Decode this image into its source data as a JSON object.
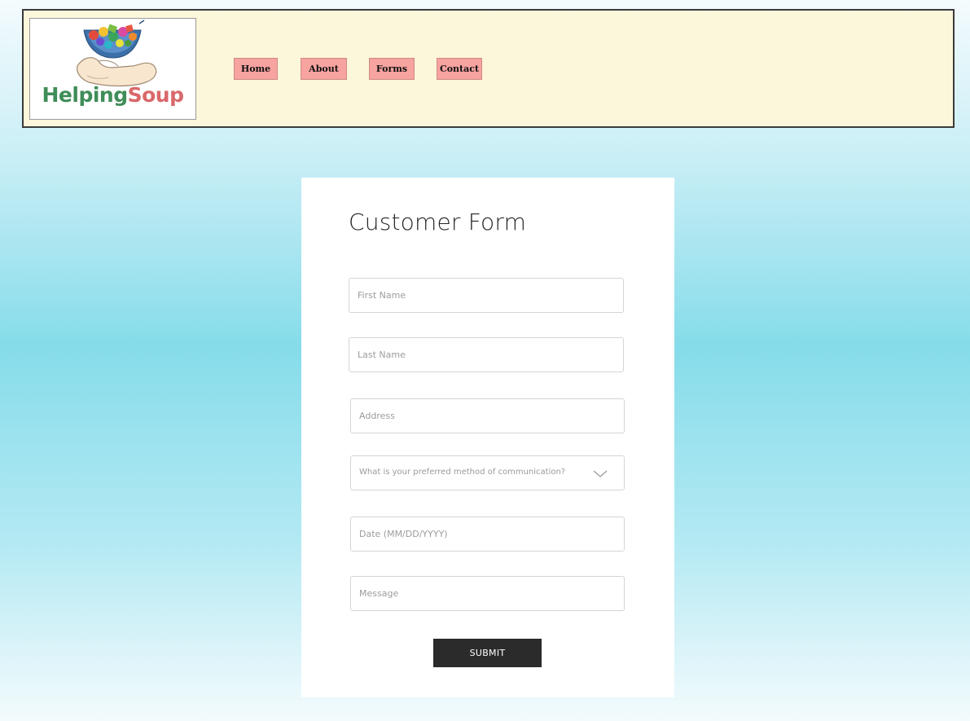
{
  "header": {
    "logo": {
      "word_part1": "Helping",
      "word_part2": "Soup",
      "icon": "hand-holding-bowl-logo"
    },
    "nav": [
      {
        "label": "Home"
      },
      {
        "label": "About"
      },
      {
        "label": "Forms"
      },
      {
        "label": "Contact"
      }
    ]
  },
  "form": {
    "title": "Customer Form",
    "fields": {
      "first_name": {
        "placeholder": "First Name",
        "value": ""
      },
      "last_name": {
        "placeholder": "Last Name",
        "value": ""
      },
      "address": {
        "placeholder": "Address",
        "value": ""
      },
      "communication": {
        "selected": "What is your preferred method of communication?",
        "icon": "chevron-down-icon"
      },
      "date": {
        "placeholder": "Date (MM/DD/YYYY)",
        "value": ""
      },
      "message": {
        "placeholder": "Message",
        "value": ""
      }
    },
    "submit_label": "SUBMIT"
  },
  "colors": {
    "header_bg": "#fcf6da",
    "nav_button_bg": "#f7a3a0",
    "submit_bg": "#2b2b2b",
    "logo_green": "#3f8d58",
    "logo_red": "#d9686a"
  }
}
